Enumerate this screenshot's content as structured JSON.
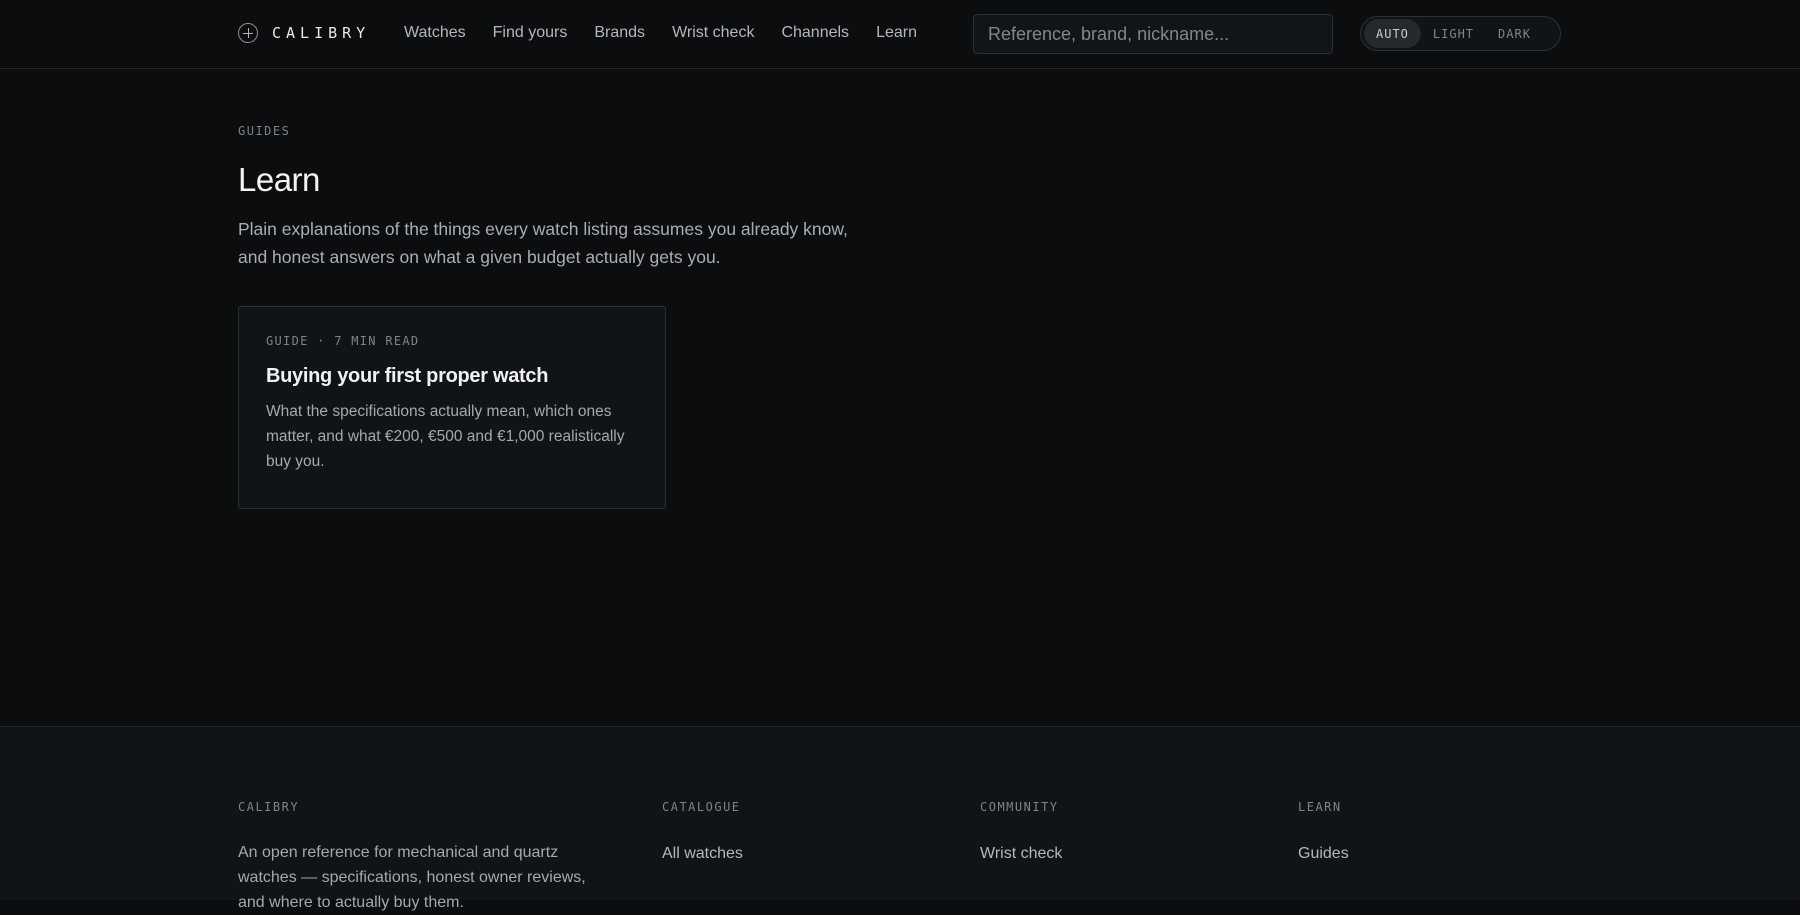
{
  "header": {
    "logo_text": "CALIBRY",
    "nav": [
      "Watches",
      "Find yours",
      "Brands",
      "Wrist check",
      "Channels",
      "Learn"
    ],
    "search_placeholder": "Reference, brand, nickname...",
    "theme_options": [
      "AUTO",
      "LIGHT",
      "DARK"
    ],
    "theme_selected": "AUTO"
  },
  "page": {
    "eyebrow": "GUIDES",
    "title": "Learn",
    "lead": "Plain explanations of the things every watch listing assumes you already know, and honest answers on what a given budget actually gets you."
  },
  "guides": [
    {
      "meta": "GUIDE · 7 MIN READ",
      "title": "Buying your first proper watch",
      "description": "What the specifications actually mean, which ones matter, and what €200, €500 and €1,000 realistically buy you."
    }
  ],
  "footer": {
    "brand_heading": "CALIBRY",
    "brand_text": "An open reference for mechanical and quartz watches — specifications, honest owner reviews, and where to actually buy them.",
    "columns": [
      {
        "heading": "CATALOGUE",
        "links": [
          "All watches"
        ]
      },
      {
        "heading": "COMMUNITY",
        "links": [
          "Wrist check"
        ]
      },
      {
        "heading": "LEARN",
        "links": [
          "Guides"
        ]
      }
    ]
  },
  "colors": {
    "background": "#0b0d0f",
    "surface": "#111417",
    "border": "#2b3036",
    "text_primary": "#f2f3f4",
    "text_muted": "#a4a9ae"
  }
}
